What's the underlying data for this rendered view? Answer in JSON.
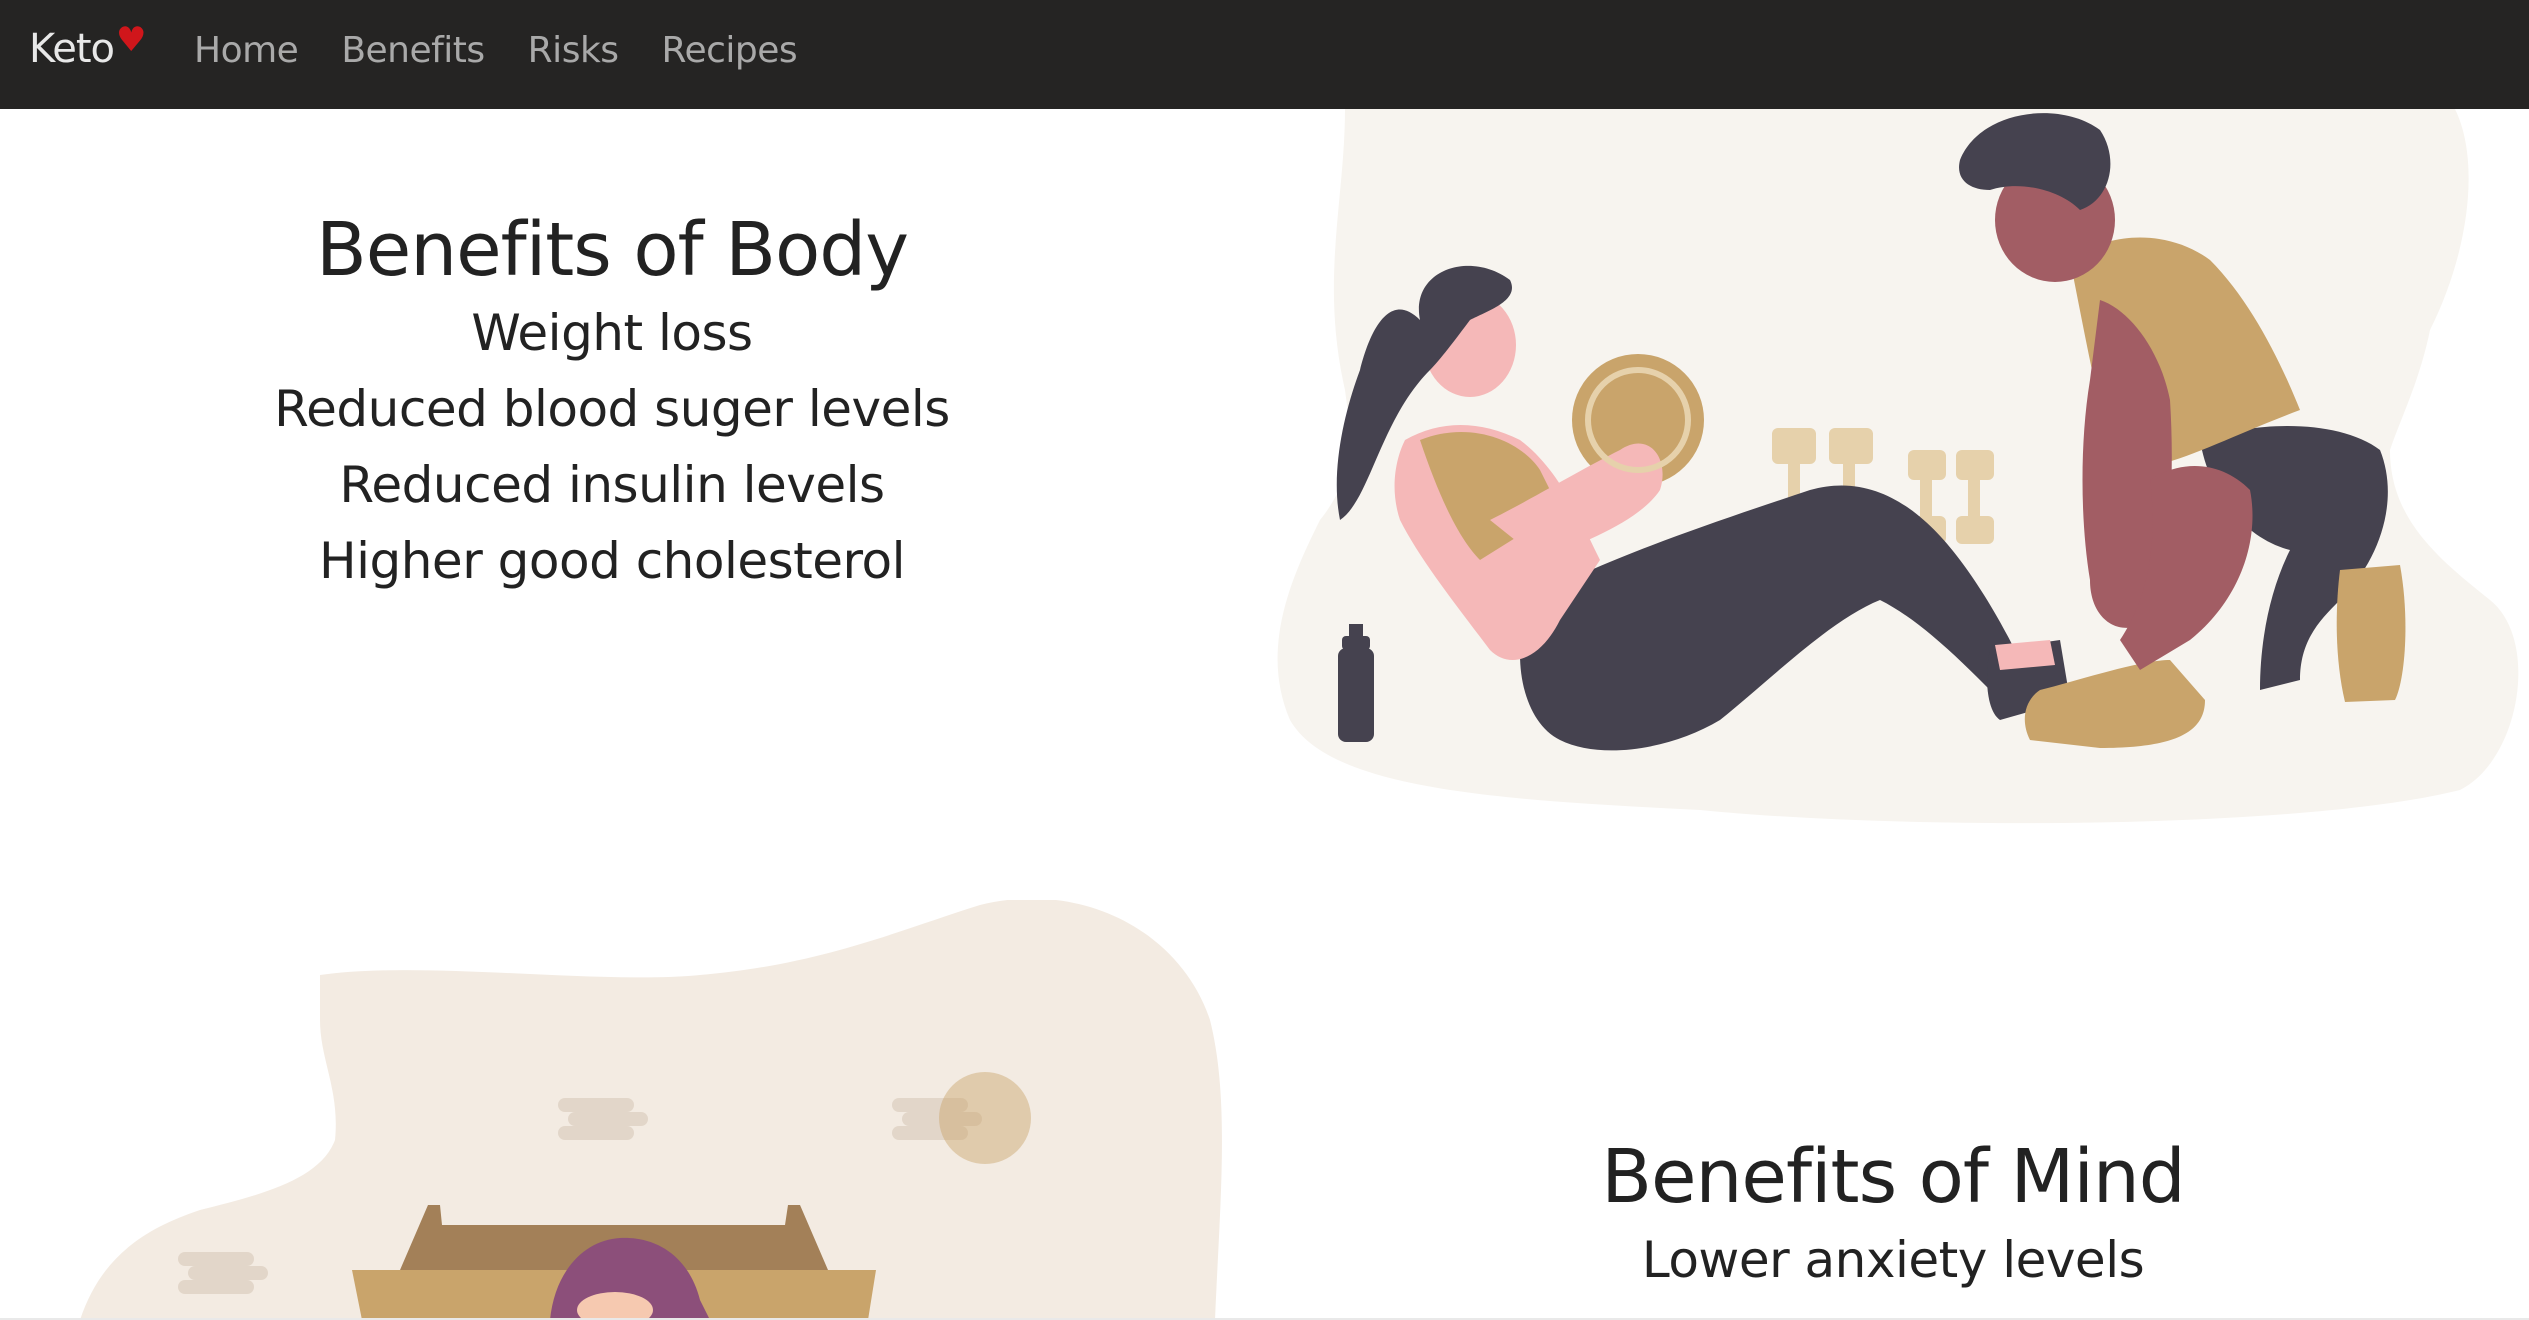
{
  "nav": {
    "brand": "Keto",
    "brand_icon": "heart-icon",
    "brand_icon_color": "#d0161b",
    "links": [
      {
        "label": "Home"
      },
      {
        "label": "Benefits"
      },
      {
        "label": "Risks"
      },
      {
        "label": "Recipes"
      }
    ]
  },
  "body_section": {
    "title": "Benefits of Body",
    "items": [
      "Weight loss",
      "Reduced blood suger levels",
      "Reduced insulin levels",
      "Higher good cholesterol"
    ]
  },
  "mind_section": {
    "title": "Benefits of Mind",
    "items": [
      "Lower anxiety levels"
    ]
  },
  "colors": {
    "navbar": "#252423",
    "nav_link": "#a9a9a9",
    "text": "#222222",
    "blob_light": "#f7f4ef",
    "blob_beige": "#f3ebe2",
    "tan": "#c9a46b",
    "dark_clothes": "#45424f",
    "skin_dark": "#a25d64",
    "skin_light": "#f5b8b8"
  }
}
